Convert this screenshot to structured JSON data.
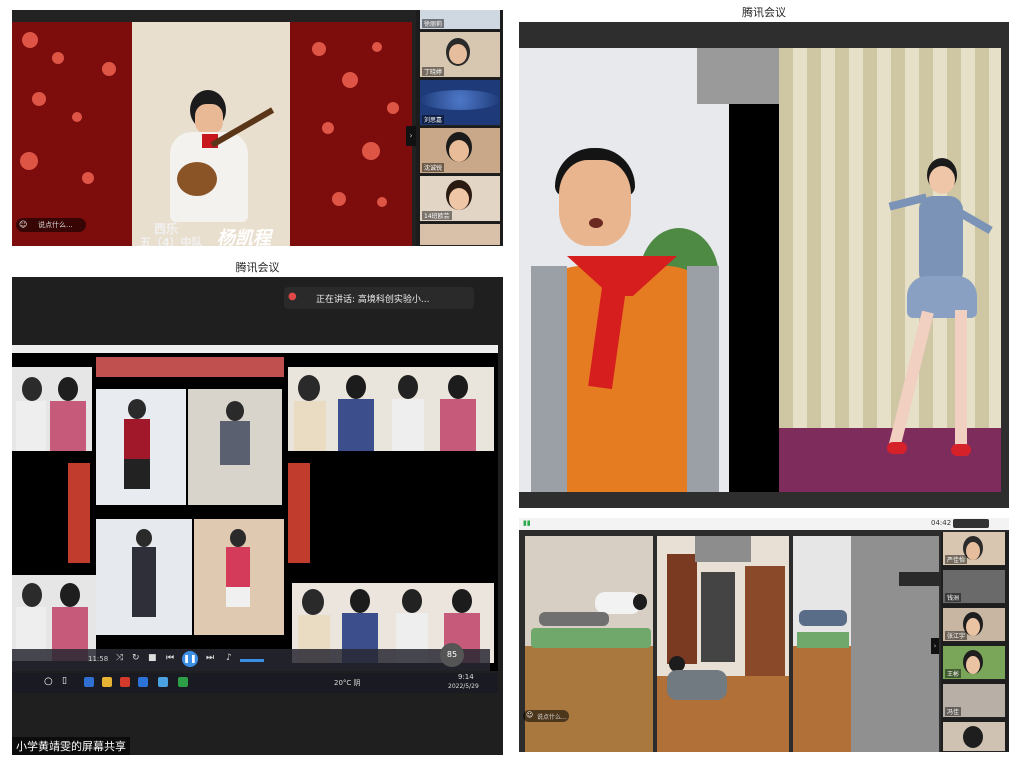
{
  "panel_a": {
    "performer_title": "西乐",
    "performer_class": "五（4）中队",
    "performer_name": "杨凯程",
    "chat_hint": "说点什么...",
    "participants": [
      "徐丽莉",
      "丁晓婷",
      "刘思嘉",
      "沈诚锐",
      "14班欧芸",
      ""
    ]
  },
  "panel_b": {
    "app_title": "腾讯会议",
    "speaking_label": "正在讲话: 高境科创实验小...",
    "share_caption": "小学黄靖雯的屏幕共享",
    "player_time": "11:58",
    "zoom_badge": "85",
    "clock_time": "9:14",
    "clock_date": "2022/5/29",
    "weather": "20°C 阴"
  },
  "panel_c": {
    "app_title": "腾讯会议"
  },
  "panel_d": {
    "status_time": "04:42",
    "chat_hint": "说点什么...",
    "participants": [
      "严佳怡",
      "钱洲",
      "张江宇",
      "王彬",
      "冯佳",
      ""
    ]
  },
  "colors": {
    "dark_bar": "#2b2b2b",
    "red_bg": "#8e1010",
    "scarf": "#d71e1e",
    "orange": "#e67c22"
  }
}
